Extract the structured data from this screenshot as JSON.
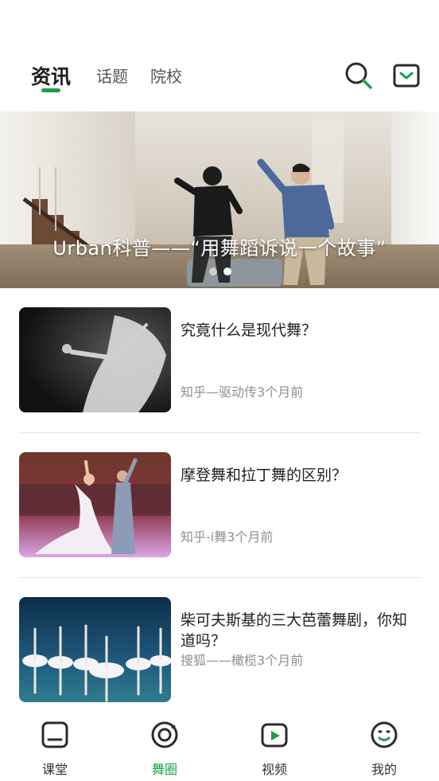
{
  "top_nav": {
    "tabs": [
      "资讯",
      "话题",
      "院校"
    ],
    "active_tab": "资讯",
    "icons": [
      "search-icon",
      "message-icon"
    ]
  },
  "banner": {
    "caption": "Urban科普——“用舞蹈诉说一个故事”",
    "slide_count": 2,
    "active_slide": 1
  },
  "news": [
    {
      "title": "究竟什么是现代舞？",
      "source": "知乎—驱动传",
      "time": "3个月前"
    },
    {
      "title": "摩登舞和拉丁舞的区别？",
      "source": "知乎-i舞",
      "time": "3个月前"
    },
    {
      "title": "柴可夫斯基的三大芭蕾舞剧，你知道吗？",
      "source": "搜狐——橄榄",
      "time": "3个月前"
    }
  ],
  "bottom_nav": {
    "items": [
      {
        "label": "课堂",
        "icon": "classroom-icon"
      },
      {
        "label": "舞圈",
        "icon": "dance-circle-icon"
      },
      {
        "label": "视频",
        "icon": "video-icon"
      },
      {
        "label": "我的",
        "icon": "profile-icon"
      }
    ],
    "active": "舞圈"
  },
  "colors": {
    "accent": "#19a04a",
    "text": "#222222",
    "muted": "#8f8f8f",
    "divider": "#e2e2e2"
  }
}
